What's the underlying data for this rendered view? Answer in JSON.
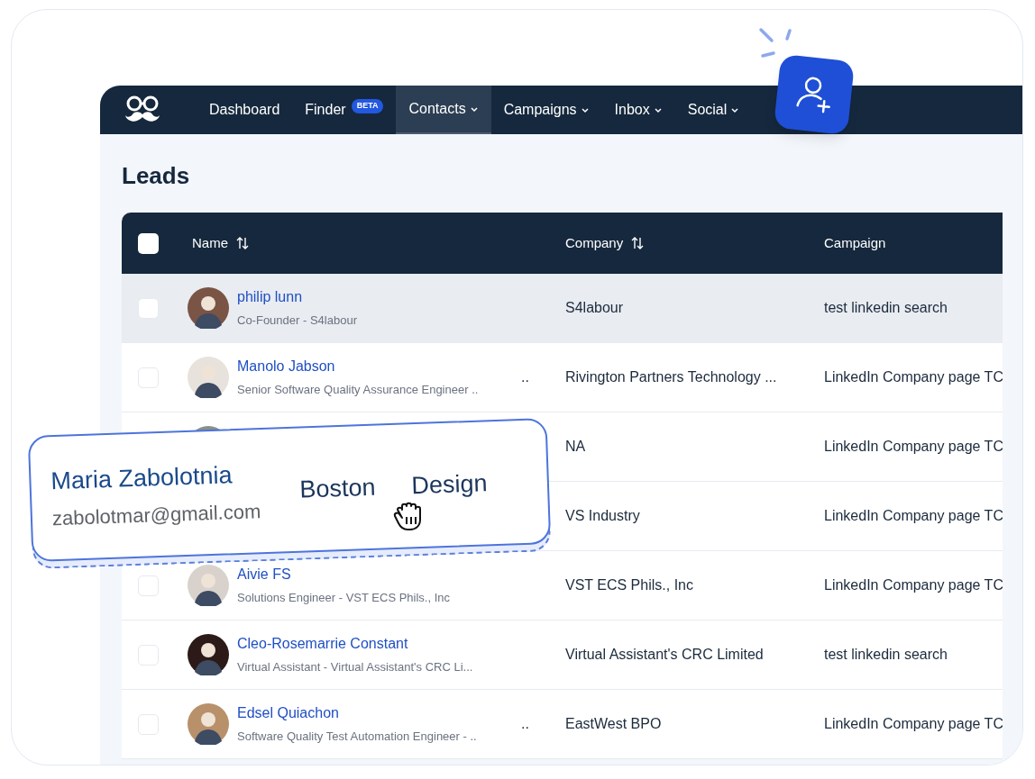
{
  "nav": {
    "items": [
      {
        "label": "Dashboard",
        "selected": false,
        "has_caret": false
      },
      {
        "label": "Finder",
        "selected": false,
        "has_caret": false,
        "badge": "BETA"
      },
      {
        "label": "Contacts",
        "selected": true,
        "has_caret": true
      },
      {
        "label": "Campaigns",
        "selected": false,
        "has_caret": true
      },
      {
        "label": "Inbox",
        "selected": false,
        "has_caret": true
      },
      {
        "label": "Social",
        "selected": false,
        "has_caret": true
      }
    ]
  },
  "page_title": "Leads",
  "table": {
    "select_all": {
      "checked": false
    },
    "columns": [
      {
        "label": "Name",
        "sortable": true
      },
      {
        "label": "Company",
        "sortable": true
      },
      {
        "label": "Campaign",
        "sortable": false
      }
    ],
    "rows": [
      {
        "name": "philip lunn",
        "title": "Co-Founder - S4labour",
        "company": "S4labour",
        "campaign": "test linkedin search",
        "checked": false,
        "highlighted": true
      },
      {
        "name": "Manolo Jabson",
        "title": "Senior Software Quality Assurance Engineer ..",
        "overflow": "..",
        "company": "Rivington Partners Technology ...",
        "campaign": "LinkedIn Company page TC",
        "checked": false,
        "highlighted": false
      },
      {
        "company": "NA",
        "campaign": "LinkedIn Company page TC",
        "highlighted": false
      },
      {
        "company": "VS Industry",
        "campaign": "LinkedIn Company page TC",
        "highlighted": false
      },
      {
        "name": "Aivie FS",
        "title": "Solutions Engineer - VST ECS Phils., Inc",
        "company": "VST ECS Phils., Inc",
        "campaign": "LinkedIn Company page TC",
        "checked": false,
        "highlighted": false
      },
      {
        "name": "Cleo-Rosemarrie Constant",
        "title": "Virtual Assistant - Virtual Assistant's CRC Li...",
        "company": "Virtual Assistant's CRC Limited",
        "campaign": "test linkedin search",
        "checked": false,
        "highlighted": false
      },
      {
        "name": "Edsel Quiachon",
        "title": "Software Quality Test Automation Engineer - ..",
        "overflow": "..",
        "company": "EastWest BPO",
        "campaign": "LinkedIn Company page TC",
        "checked": false,
        "highlighted": false
      }
    ]
  },
  "contact_card": {
    "name": "Maria Zabolotnia",
    "email": "zabolotmar@gmail.com",
    "city": "Boston",
    "department": "Design"
  }
}
